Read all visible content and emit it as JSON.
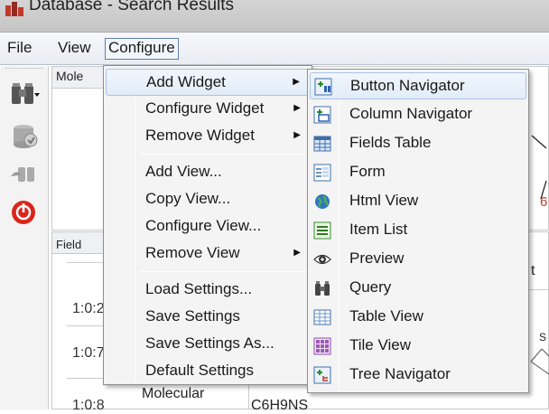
{
  "window": {
    "title": "Database - Search Results"
  },
  "menubar": {
    "file": "File",
    "view": "View",
    "configure": "Configure"
  },
  "background": {
    "panel_top_label": "Mole",
    "panel_bottom_label": "Field",
    "rows": [
      "1:0:2",
      "1:0:7",
      "1:0:8"
    ],
    "row3_name": "Molecular",
    "row3_formula": "C6H9NS",
    "right_frag_t": "t",
    "right_frag_6": "6",
    "right_frag_s": "S"
  },
  "configure_menu": {
    "items": [
      {
        "label": "Add Widget",
        "has_submenu": true
      },
      {
        "label": "Configure Widget",
        "has_submenu": true
      },
      {
        "label": "Remove Widget",
        "has_submenu": true
      },
      {
        "label": "Add View..."
      },
      {
        "label": "Copy View..."
      },
      {
        "label": "Configure View..."
      },
      {
        "label": "Remove View",
        "has_submenu": true
      },
      {
        "label": "Load Settings..."
      },
      {
        "label": "Save Settings"
      },
      {
        "label": "Save Settings As..."
      },
      {
        "label": "Default Settings"
      }
    ]
  },
  "add_widget_submenu": {
    "items": [
      {
        "label": "Button Navigator",
        "icon": "button-navigator-icon"
      },
      {
        "label": "Column Navigator",
        "icon": "column-navigator-icon"
      },
      {
        "label": "Fields Table",
        "icon": "fields-table-icon"
      },
      {
        "label": "Form",
        "icon": "form-icon"
      },
      {
        "label": "Html View",
        "icon": "html-view-icon"
      },
      {
        "label": "Item List",
        "icon": "item-list-icon"
      },
      {
        "label": "Preview",
        "icon": "preview-eye-icon"
      },
      {
        "label": "Query",
        "icon": "query-binoculars-icon"
      },
      {
        "label": "Table View",
        "icon": "table-view-icon"
      },
      {
        "label": "Tile View",
        "icon": "tile-view-icon"
      },
      {
        "label": "Tree Navigator",
        "icon": "tree-navigator-icon"
      }
    ]
  },
  "colors": {
    "highlight": "#e2ecf8",
    "highlight_border": "#aac4e6",
    "stop_red": "#d9261c"
  }
}
